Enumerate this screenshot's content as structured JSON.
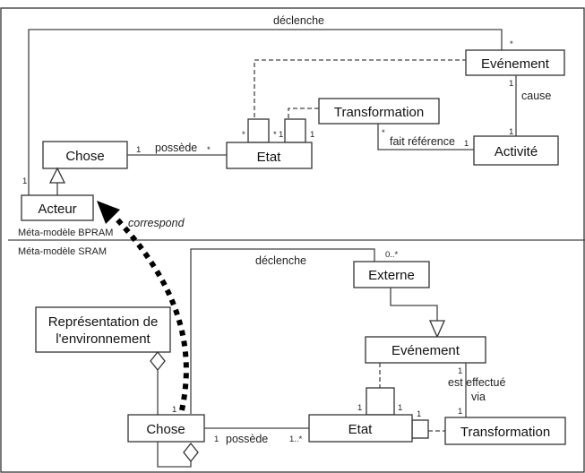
{
  "bpram": {
    "section_label": "Méta-modèle BPRAM",
    "classes": {
      "evenement": "Evénement",
      "transformation": "Transformation",
      "chose": "Chose",
      "etat": "Etat",
      "activite": "Activité",
      "acteur": "Acteur"
    },
    "associations": {
      "declenche": {
        "label": "déclenche",
        "mult_acteur": "1",
        "mult_evenement": "*"
      },
      "cause": {
        "label": "cause",
        "mult_evenement": "1",
        "mult_activite": "1"
      },
      "possede": {
        "label": "possède",
        "mult_chose": "1",
        "mult_etat": "*"
      },
      "fait_reference": {
        "label": "fait référence",
        "mult_transformation": "*",
        "mult_activite": "1"
      },
      "etat_evenement": {
        "mult_left": "*",
        "mult_right": "*"
      },
      "etat_transformation": {
        "mult_left": "1",
        "mult_right": "1"
      }
    }
  },
  "sram": {
    "section_label": "Méta-modèle SRAM",
    "classes": {
      "representation": "Représentation de",
      "representation_line2": "l'environnement",
      "externe": "Externe",
      "evenement": "Evénement",
      "chose": "Chose",
      "etat": "Etat",
      "transformation": "Transformation"
    },
    "associations": {
      "declenche": {
        "label": "déclenche",
        "mult_chose": "1",
        "mult_externe": "0..*"
      },
      "possede": {
        "label": "possède",
        "mult_chose": "1",
        "mult_etat": "1..*"
      },
      "est_effectue_via": {
        "label_line1": "est effectué",
        "label_line2": "via",
        "mult_evenement": "1",
        "mult_transformation": "1"
      },
      "etat_evenement": {
        "mult_left": "1",
        "mult_right": "1"
      },
      "etat_transformation": {
        "mult": "1"
      }
    }
  },
  "mapping": {
    "label": "correspond"
  }
}
